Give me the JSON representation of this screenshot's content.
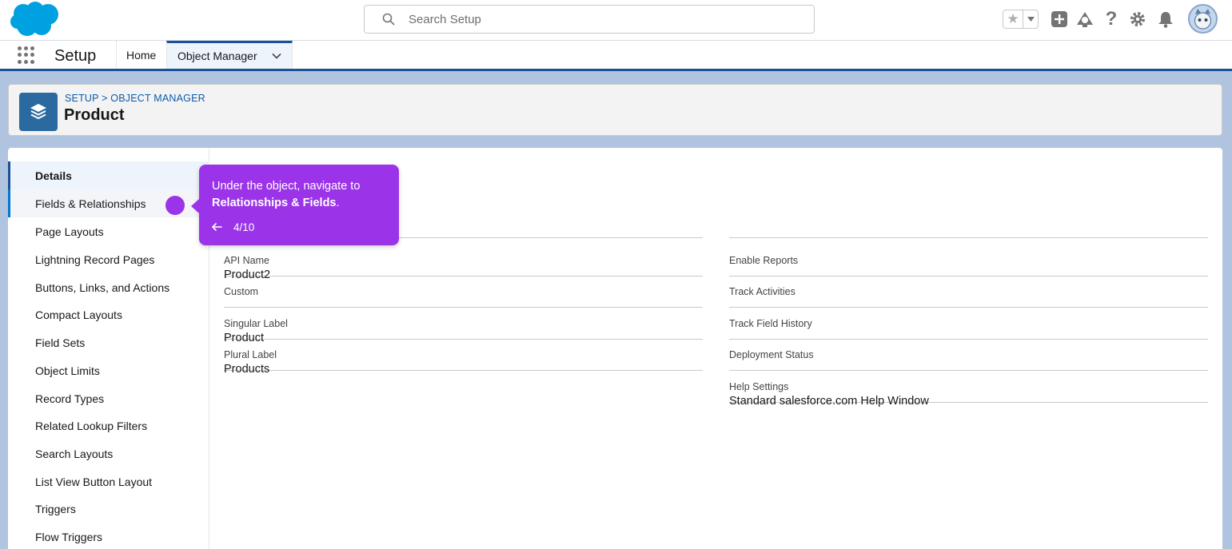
{
  "header": {
    "search_placeholder": "Search Setup"
  },
  "nav": {
    "app_name": "Setup",
    "tabs": [
      {
        "label": "Home"
      },
      {
        "label": "Object Manager"
      }
    ]
  },
  "page": {
    "breadcrumb": "SETUP > OBJECT MANAGER",
    "title": "Product"
  },
  "sidebar": {
    "items": [
      {
        "label": "Details"
      },
      {
        "label": "Fields & Relationships"
      },
      {
        "label": "Page Layouts"
      },
      {
        "label": "Lightning Record Pages"
      },
      {
        "label": "Buttons, Links, and Actions"
      },
      {
        "label": "Compact Layouts"
      },
      {
        "label": "Field Sets"
      },
      {
        "label": "Object Limits"
      },
      {
        "label": "Record Types"
      },
      {
        "label": "Related Lookup Filters"
      },
      {
        "label": "Search Layouts"
      },
      {
        "label": "List View Button Layout"
      },
      {
        "label": "Triggers"
      },
      {
        "label": "Flow Triggers"
      }
    ]
  },
  "details": {
    "left": [
      {
        "label": "API Name",
        "value": "Product2"
      },
      {
        "label": "Custom",
        "value": ""
      },
      {
        "label": "Singular Label",
        "value": "Product"
      },
      {
        "label": "Plural Label",
        "value": "Products"
      }
    ],
    "right": [
      {
        "label": "Enable Reports",
        "value": ""
      },
      {
        "label": "Track Activities",
        "value": ""
      },
      {
        "label": "Track Field History",
        "value": ""
      },
      {
        "label": "Deployment Status",
        "value": ""
      },
      {
        "label": "Help Settings",
        "value": "Standard salesforce.com Help Window"
      }
    ]
  },
  "tooltip": {
    "text_prefix": "Under the object, navigate to ",
    "text_bold": "Relationships & Fields",
    "text_suffix": ".",
    "step": "4/10"
  },
  "colors": {
    "brand_blue": "#1b5297",
    "object_icon": "#2b6aa0",
    "tour_purple": "#9b34e8",
    "salesforce_cloud": "#00a1e0"
  }
}
